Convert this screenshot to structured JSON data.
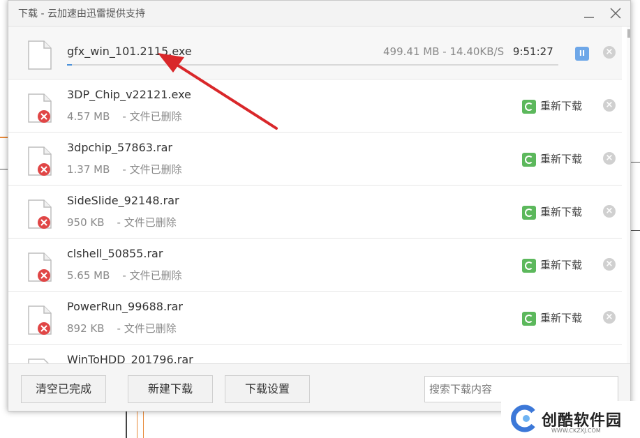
{
  "window": {
    "title": "下载 - 云加速由迅雷提供支持"
  },
  "active_download": {
    "name": "gfx_win_101.2115.exe",
    "size": "499.41 MB",
    "speed": "14.40KB/S",
    "time_left": "9:51:27",
    "progress_fraction": 0.005,
    "pause_label": "II"
  },
  "items": [
    {
      "name": "3DP_Chip_v22121.exe",
      "size": "4.57 MB",
      "status": "- 文件已删除",
      "action": "重新下载"
    },
    {
      "name": "3dpchip_57863.rar",
      "size": "1.37 MB",
      "status": "- 文件已删除",
      "action": "重新下载"
    },
    {
      "name": "SideSlide_92148.rar",
      "size": "950 KB",
      "status": "- 文件已删除",
      "action": "重新下载"
    },
    {
      "name": "clshell_50855.rar",
      "size": "5.65 MB",
      "status": "- 文件已删除",
      "action": "重新下载"
    },
    {
      "name": "PowerRun_99688.rar",
      "size": "892 KB",
      "status": "- 文件已删除",
      "action": "重新下载"
    },
    {
      "name": "WinToHDD_201796.rar"
    }
  ],
  "footer": {
    "clear_label": "清空已完成",
    "new_label": "新建下载",
    "settings_label": "下载设置",
    "search_placeholder": "搜索下载内容"
  },
  "watermark": {
    "text": "创酷软件园",
    "url": "WWW.CKZXJ.COM"
  },
  "colors": {
    "progress": "#4a90d9",
    "redownload": "#5cb85c",
    "error": "#e04646",
    "arrow": "#d9272a"
  }
}
